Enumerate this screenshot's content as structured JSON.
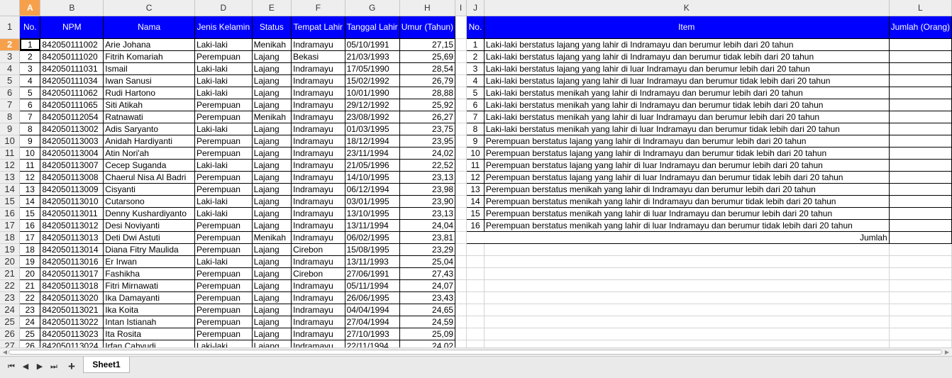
{
  "columns": {
    "row_corner": "",
    "letters": [
      "A",
      "B",
      "C",
      "D",
      "E",
      "F",
      "G",
      "H",
      "I",
      "J",
      "K",
      "L"
    ],
    "selected": "A"
  },
  "left_table": {
    "headers": [
      "No.",
      "NPM",
      "Nama",
      "Jenis Kelamin",
      "Status",
      "Tempat Lahir",
      "Tanggal Lahir",
      "Umur (Tahun)"
    ],
    "rows": [
      [
        "1",
        "842050111002",
        "Arie Johana",
        "Laki-laki",
        "Menikah",
        "Indramayu",
        "05/10/1991",
        "27,15"
      ],
      [
        "2",
        "842050111020",
        "Fitrih Komariah",
        "Perempuan",
        "Lajang",
        "Bekasi",
        "21/03/1993",
        "25,69"
      ],
      [
        "3",
        "842050111031",
        "Ismail",
        "Laki-laki",
        "Lajang",
        "Indramayu",
        "17/05/1990",
        "28,54"
      ],
      [
        "4",
        "842050111034",
        "Iwan Sanusi",
        "Laki-laki",
        "Lajang",
        "Indramayu",
        "15/02/1992",
        "26,79"
      ],
      [
        "5",
        "842050111062",
        "Rudi Hartono",
        "Laki-laki",
        "Lajang",
        "Indramayu",
        "10/01/1990",
        "28,88"
      ],
      [
        "6",
        "842050111065",
        "Siti Atikah",
        "Perempuan",
        "Lajang",
        "Indramayu",
        "29/12/1992",
        "25,92"
      ],
      [
        "7",
        "842050112054",
        "Ratnawati",
        "Perempuan",
        "Menikah",
        "Indramayu",
        "23/08/1992",
        "26,27"
      ],
      [
        "8",
        "842050113002",
        "Adis Saryanto",
        "Laki-laki",
        "Lajang",
        "Indramayu",
        "01/03/1995",
        "23,75"
      ],
      [
        "9",
        "842050113003",
        "Anidah Hardiyanti",
        "Perempuan",
        "Lajang",
        "Indramayu",
        "18/12/1994",
        "23,95"
      ],
      [
        "10",
        "842050113004",
        "Atin Nori'ah",
        "Perempuan",
        "Lajang",
        "Indramayu",
        "23/11/1994",
        "24,02"
      ],
      [
        "11",
        "842050113007",
        "Cecep Suganda",
        "Laki-laki",
        "Lajang",
        "Indramayu",
        "21/05/1996",
        "22,52"
      ],
      [
        "12",
        "842050113008",
        "Chaerul Nisa Al Badri",
        "Perempuan",
        "Lajang",
        "Indramayu",
        "14/10/1995",
        "23,13"
      ],
      [
        "13",
        "842050113009",
        "Cisyanti",
        "Perempuan",
        "Lajang",
        "Indramayu",
        "06/12/1994",
        "23,98"
      ],
      [
        "14",
        "842050113010",
        "Cutarsono",
        "Laki-laki",
        "Lajang",
        "Indramayu",
        "03/01/1995",
        "23,90"
      ],
      [
        "15",
        "842050113011",
        "Denny Kushardiyanto",
        "Laki-laki",
        "Lajang",
        "Indramayu",
        "13/10/1995",
        "23,13"
      ],
      [
        "16",
        "842050113012",
        "Desi Noviyanti",
        "Perempuan",
        "Lajang",
        "Indramayu",
        "13/11/1994",
        "24,04"
      ],
      [
        "17",
        "842050113013",
        "Deti Dwi Astuti",
        "Perempuan",
        "Menikah",
        "Indramayu",
        "06/02/1995",
        "23,81"
      ],
      [
        "18",
        "842050113014",
        "Diana Fitry Maulida",
        "Perempuan",
        "Lajang",
        "Cirebon",
        "15/08/1995",
        "23,29"
      ],
      [
        "19",
        "842050113016",
        "Er Irwan",
        "Laki-laki",
        "Lajang",
        "Indramayu",
        "13/11/1993",
        "25,04"
      ],
      [
        "20",
        "842050113017",
        "Fashikha",
        "Perempuan",
        "Lajang",
        "Cirebon",
        "27/06/1991",
        "27,43"
      ],
      [
        "21",
        "842050113018",
        "Fitri Mirnawati",
        "Perempuan",
        "Lajang",
        "Indramayu",
        "05/11/1994",
        "24,07"
      ],
      [
        "22",
        "842050113020",
        "Ika Damayanti",
        "Perempuan",
        "Lajang",
        "Indramayu",
        "26/06/1995",
        "23,43"
      ],
      [
        "23",
        "842050113021",
        "Ika Koita",
        "Perempuan",
        "Lajang",
        "Indramayu",
        "04/04/1994",
        "24,65"
      ],
      [
        "24",
        "842050113022",
        "Intan Istianah",
        "Perempuan",
        "Lajang",
        "Indramayu",
        "27/04/1994",
        "24,59"
      ],
      [
        "25",
        "842050113023",
        "Ita Rosita",
        "Perempuan",
        "Lajang",
        "Indramayu",
        "27/10/1993",
        "25,09"
      ],
      [
        "26",
        "842050113024",
        "Irfan Cahyudi",
        "Laki-laki",
        "Lajang",
        "Indramayu",
        "22/11/1994",
        "24,02"
      ]
    ]
  },
  "right_table": {
    "headers": [
      "No.",
      "Item",
      "Jumlah (Orang)"
    ],
    "rows": [
      [
        "1",
        "Laki-laki berstatus lajang yang lahir di Indramayu dan berumur lebih dari 20 tahun"
      ],
      [
        "2",
        "Laki-laki berstatus lajang yang lahir di Indramayu dan berumur tidak lebih dari 20 tahun"
      ],
      [
        "3",
        "Laki-laki berstatus lajang yang lahir di luar Indramayu dan berumur lebih dari 20 tahun"
      ],
      [
        "4",
        "Laki-laki berstatus lajang yang lahir di luar Indramayu dan berumur tidak lebih dari 20 tahun"
      ],
      [
        "5",
        "Laki-laki berstatus menikah yang lahir di Indramayu dan berumur lebih dari 20 tahun"
      ],
      [
        "6",
        "Laki-laki berstatus menikah yang lahir di Indramayu dan berumur tidak lebih dari 20 tahun"
      ],
      [
        "7",
        "Laki-laki berstatus menikah yang lahir di luar Indramayu dan berumur lebih dari 20 tahun"
      ],
      [
        "8",
        "Laki-laki berstatus menikah yang lahir di luar Indramayu dan berumur tidak lebih dari 20 tahun"
      ],
      [
        "9",
        "Perempuan berstatus lajang yang lahir di Indramayu dan berumur lebih dari 20 tahun"
      ],
      [
        "10",
        "Perempuan berstatus lajang yang lahir di Indramayu dan berumur tidak lebih dari 20 tahun"
      ],
      [
        "11",
        "Perempuan berstatus lajang yang lahir di luar Indramayu dan berumur lebih dari 20 tahun"
      ],
      [
        "12",
        "Perempuan berstatus lajang yang lahir di luar Indramayu dan berumur tidak lebih dari 20 tahun"
      ],
      [
        "13",
        "Perempuan berstatus menikah yang lahir di Indramayu dan berumur lebih dari 20 tahun"
      ],
      [
        "14",
        "Perempuan berstatus menikah yang lahir di Indramayu dan berumur tidak lebih dari 20 tahun"
      ],
      [
        "15",
        "Perempuan berstatus menikah yang lahir di luar Indramayu dan berumur lebih dari 20 tahun"
      ],
      [
        "16",
        "Perempuan berstatus menikah yang lahir di luar Indramayu dan berumur tidak lebih dari 20 tahun"
      ]
    ],
    "total_label": "Jumlah"
  },
  "sheet_tabs": {
    "tabs": [
      "Sheet1"
    ],
    "active": "Sheet1",
    "add_icon": "plus-icon"
  },
  "colors": {
    "header_blue": "#0000ff",
    "selected_header": "#f7a04c"
  }
}
